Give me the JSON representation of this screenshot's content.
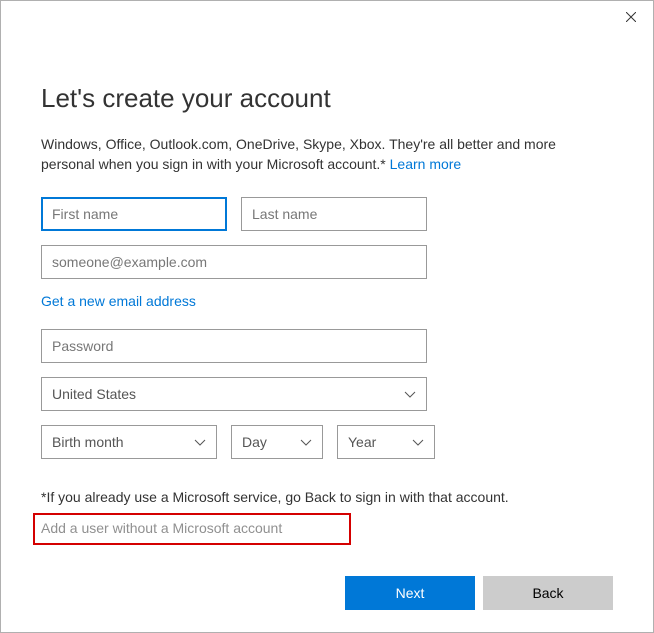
{
  "title": "Let's create your account",
  "description_pre": "Windows, Office, Outlook.com, OneDrive, Skype, Xbox. They're all better and more personal when you sign in with your Microsoft account.* ",
  "learn_more": "Learn more",
  "fields": {
    "first_name": {
      "placeholder": "First name",
      "value": ""
    },
    "last_name": {
      "placeholder": "Last name",
      "value": ""
    },
    "email": {
      "placeholder": "someone@example.com",
      "value": ""
    },
    "password": {
      "placeholder": "Password",
      "value": ""
    }
  },
  "get_new_email": "Get a new email address",
  "country": {
    "selected": "United States"
  },
  "birth": {
    "month": "Birth month",
    "day": "Day",
    "year": "Year"
  },
  "footnote": "*If you already use a Microsoft service, go Back to sign in with that account.",
  "no_msa_link": "Add a user without a Microsoft account",
  "buttons": {
    "next": "Next",
    "back": "Back"
  }
}
